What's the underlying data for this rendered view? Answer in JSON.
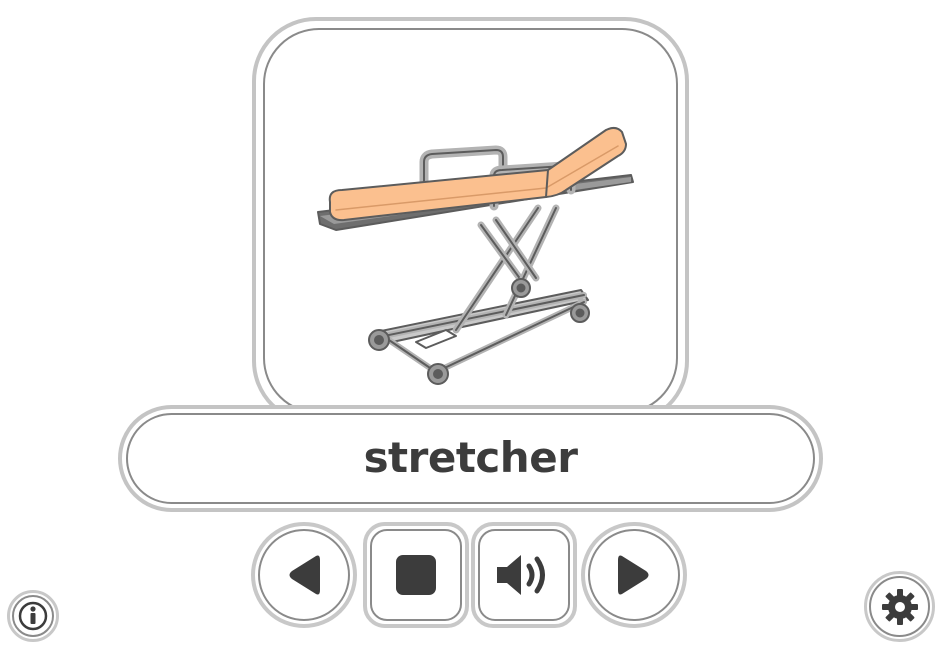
{
  "flashcard": {
    "word": "stretcher",
    "image_icon": "stretcher-icon"
  },
  "controls": {
    "previous": {
      "icon": "triangle-left-icon"
    },
    "stop": {
      "icon": "stop-square-icon"
    },
    "speak": {
      "icon": "speaker-sound-icon"
    },
    "next": {
      "icon": "triangle-right-icon"
    }
  },
  "corner": {
    "info_icon": "info-icon",
    "settings_icon": "gear-icon"
  },
  "colors": {
    "mattress": "#fbc08f",
    "frame": "#b3b3b3",
    "outline": "#5c5c5c",
    "border_light": "#c4c4c4",
    "border_dark": "#8a8a8a",
    "icon_dark": "#3c3c3c"
  }
}
